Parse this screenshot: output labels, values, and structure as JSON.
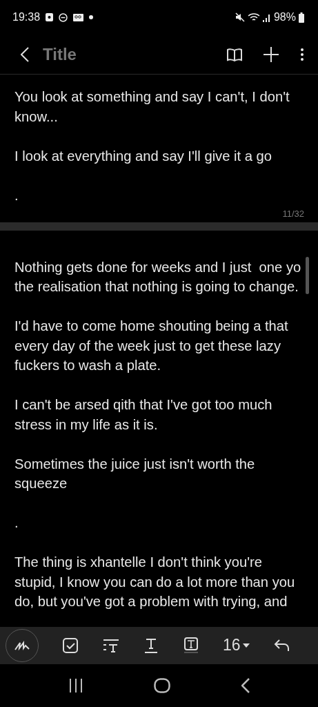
{
  "status_bar": {
    "time": "19:38",
    "battery": "98%"
  },
  "app_bar": {
    "title": "Title"
  },
  "pages": [
    {
      "paragraphs": [
        "You look at something and say I can't, I don't know...",
        "I look at everything and say I'll give it a go",
        "."
      ],
      "counter": "11/32"
    },
    {
      "paragraphs": [
        "Nothing gets done for weeks and I just  one yo the realisation that nothing is going to change.",
        "I'd have to come home shouting being a that every day of the week just to get these lazy fuckers to wash a plate.",
        "I can't be arsed qith that I've got too much stress in my life as it is.",
        "Sometimes the juice just isn't worth the squeeze",
        ".",
        "The thing is xhantelle I don't think you're stupid, I know you can do a lot more than you do, but you've got a problem with trying, and"
      ]
    }
  ],
  "toolbar": {
    "font_size": "16"
  }
}
